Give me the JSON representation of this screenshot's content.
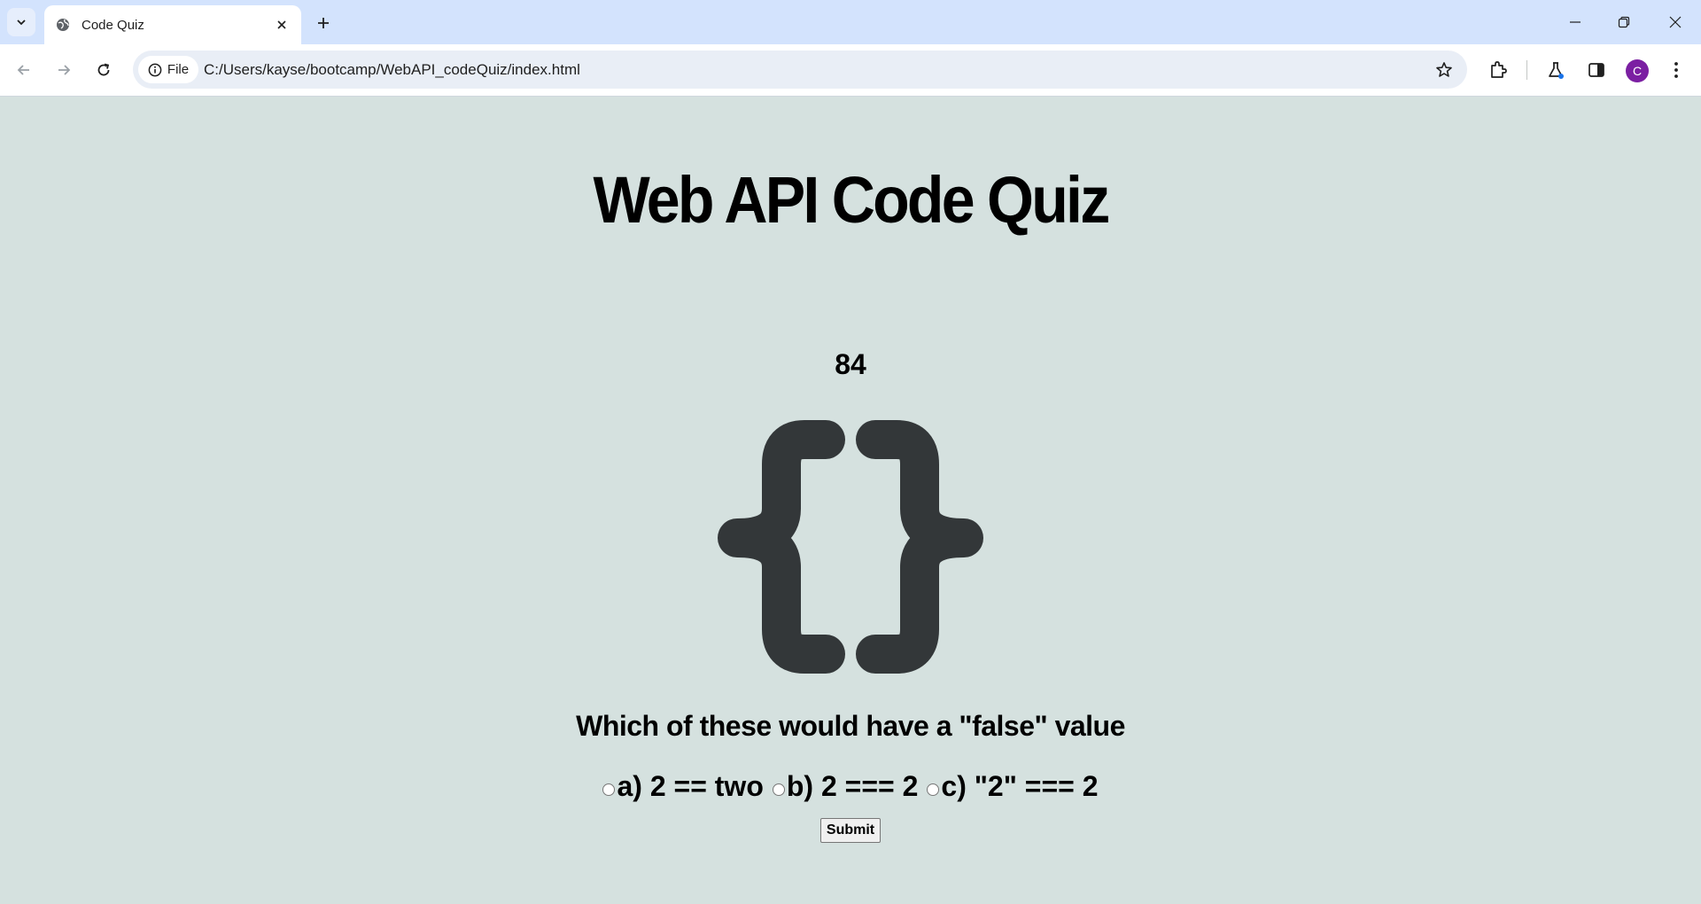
{
  "browser": {
    "tab_title": "Code Quiz",
    "site_chip_label": "File",
    "url": "C:/Users/kayse/bootcamp/WebAPI_codeQuiz/index.html",
    "avatar_letter": "C",
    "avatar_color": "#7b1fa2"
  },
  "quiz": {
    "title": "Web API Code Quiz",
    "timer": "84",
    "question": "Which of these would have a \"false\" value",
    "choices": [
      {
        "label": "a) 2 == two"
      },
      {
        "label": "b) 2 === 2"
      },
      {
        "label": "c) \"2\" === 2"
      }
    ],
    "submit_label": "Submit",
    "logo_icon": "curly-braces-icon",
    "logo_color": "#333739"
  },
  "colors": {
    "page_background": "#d5e1df",
    "tabstrip": "#d3e3fd"
  }
}
